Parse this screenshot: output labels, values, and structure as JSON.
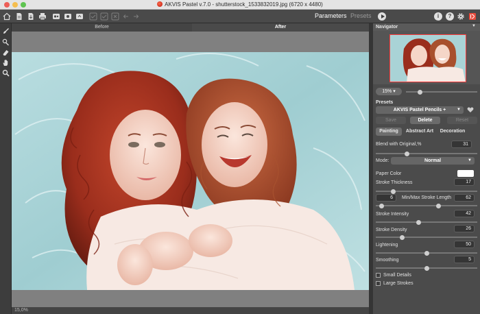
{
  "window": {
    "title": "AKVIS Pastel v.7.0 - shutterstock_1533832019.jpg (6720 x 4480)"
  },
  "toolbar": {
    "parameters_label": "Parameters",
    "presets_label": "Presets",
    "info_glyph": "i",
    "help_glyph": "?"
  },
  "canvas": {
    "before_label": "Before",
    "after_label": "After",
    "zoom_status": "15,0%"
  },
  "navigator": {
    "title": "Navigator",
    "zoom_value": "15%"
  },
  "presets": {
    "label": "Presets",
    "selected": "AKVIS Pastel Pencils +",
    "save_label": "Save",
    "delete_label": "Delete",
    "reset_label": "Reset"
  },
  "settings_tabs": {
    "painting": "Painting",
    "abstract_art": "Abstract Art",
    "decoration": "Decoration",
    "active": "painting"
  },
  "params": {
    "blend_label": "Blend with Original,%",
    "blend_value": "31",
    "mode_label": "Mode:",
    "mode_value": "Normal",
    "paper_color_label": "Paper Color",
    "paper_color": "#ffffff",
    "stroke_thickness_label": "Stroke Thickness",
    "stroke_thickness_value": "17",
    "stroke_min_value": "6",
    "stroke_length_label": "Min/Max Stroke Length",
    "stroke_max_value": "62",
    "stroke_intensity_label": "Stroke Intensity",
    "stroke_intensity_value": "42",
    "stroke_density_label": "Stroke Density",
    "stroke_density_value": "26",
    "lightening_label": "Lightening",
    "lightening_value": "50",
    "smoothing_label": "Smoothing",
    "smoothing_value": "5",
    "small_details_label": "Small Details",
    "small_details_checked": false,
    "large_strokes_label": "Large Strokes",
    "large_strokes_checked": false
  },
  "sliders": {
    "navigator_zoom": 0.2,
    "blend": 0.31,
    "stroke_thickness": 0.17,
    "stroke_min": 0.06,
    "stroke_max": 0.62,
    "stroke_intensity": 0.42,
    "stroke_density": 0.26,
    "lightening": 0.5,
    "smoothing": 0.5
  },
  "colors": {
    "accent": "#e84b3c",
    "panel_bg": "#4b4b4b",
    "canvas_bg": "#808080"
  }
}
